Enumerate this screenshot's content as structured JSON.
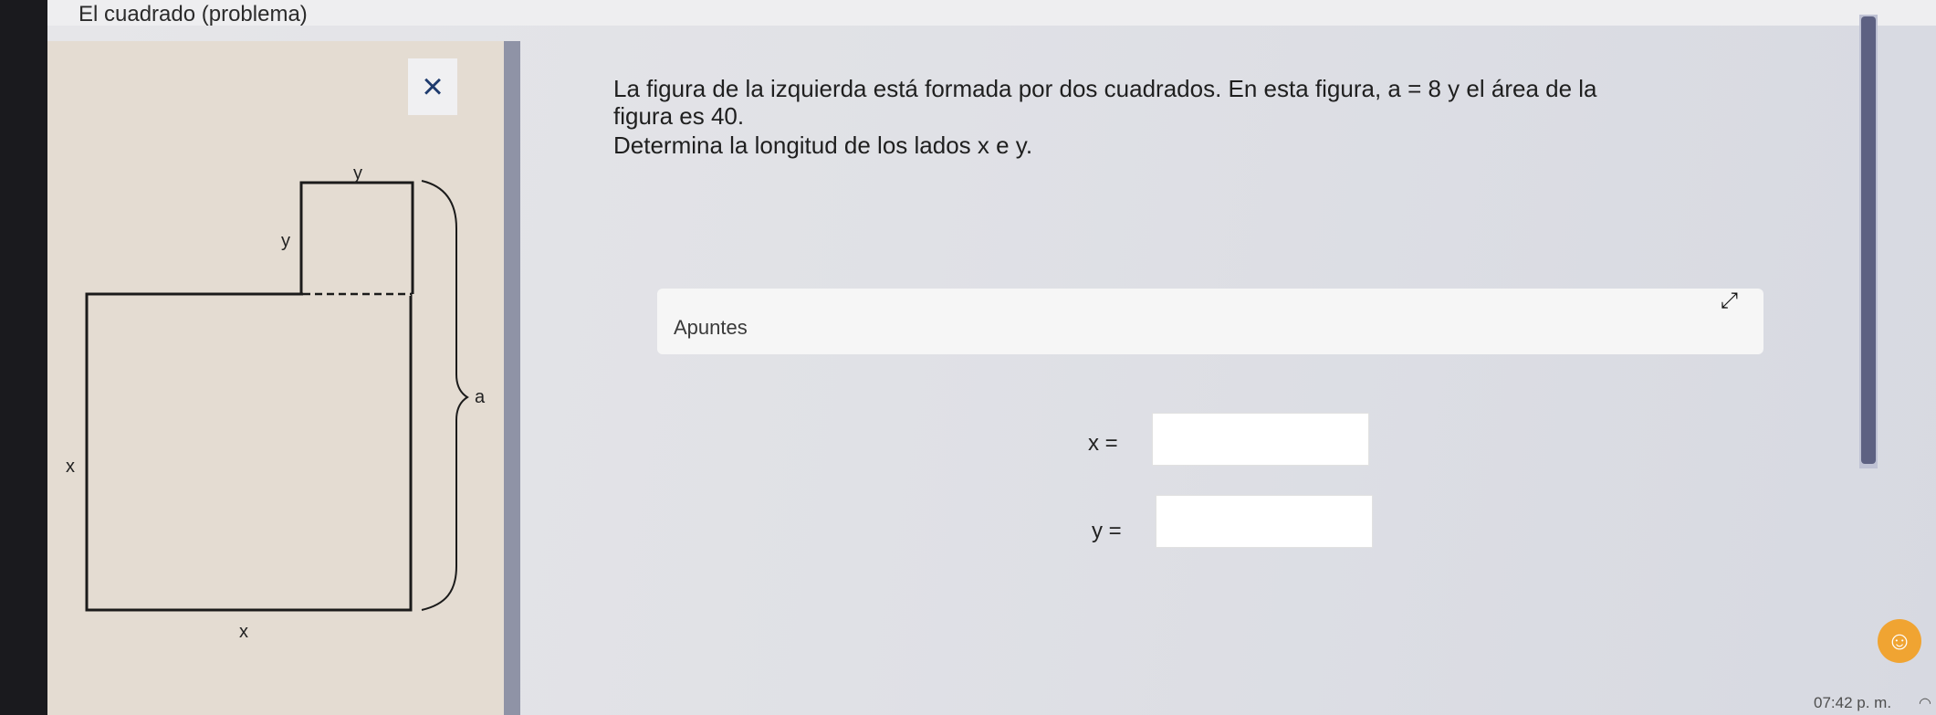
{
  "window": {
    "title": "El cuadrado (problema)"
  },
  "close_button": {
    "label": "×"
  },
  "figure": {
    "label_y_top": "y",
    "label_y_side": "y",
    "label_a": "a",
    "label_x_side": "x",
    "label_x_bottom": "x"
  },
  "question": {
    "line1": "La figura de la izquierda está formada por dos cuadrados. En esta figura, a = 8 y el área de la",
    "line2": "figura es 40.",
    "line3": "Determina la longitud de los lados x e y."
  },
  "notes": {
    "label": "Apuntes",
    "expand_icon": "expand-icon"
  },
  "answers": {
    "x_label": "x =",
    "x_value": "",
    "y_label": "y =",
    "y_value": ""
  },
  "taskbar": {
    "clock": "07:42 p. m.",
    "assistant_icon": "chat-icon",
    "wifi_icon": "wifi-icon"
  }
}
